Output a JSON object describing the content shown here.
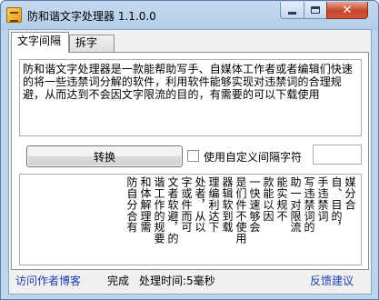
{
  "window": {
    "title": "防和谐文字处理器 1.1.0.0"
  },
  "tabs": [
    {
      "label": "文字间隔",
      "active": true
    },
    {
      "label": "拆字",
      "active": false
    }
  ],
  "input": {
    "text": "防和谐文字处理器是一款能帮助写手、自媒体工作者或者编辑们快速的将一些违禁词分解的软件，利用软件能够实现对违禁词的合理规避，从而达到不会因文字限流的目的，有需要的可以下载使用"
  },
  "convert_button": {
    "label": "转换"
  },
  "custom_separator": {
    "label": "使用自定义间隔字符",
    "checked": false,
    "value": ""
  },
  "output": {
    "columns": [
      "媒分合",
      "自、目的，",
      "手违禁词",
      "写违禁词的",
      "助一对限流",
      "能实规不",
      "款能以因",
      "一快速够会",
      "是们件不使用",
      "器辑软到载",
      "理编利达下",
      "处者，从以",
      "字或件而可",
      "文者软避，的",
      "谐工作的规要",
      "和体解理需",
      "防自分合有"
    ]
  },
  "footer": {
    "blog_link": "访问作者博客",
    "status": "完成",
    "time": "处理时间:5毫秒",
    "feedback_link": "反馈建议"
  }
}
